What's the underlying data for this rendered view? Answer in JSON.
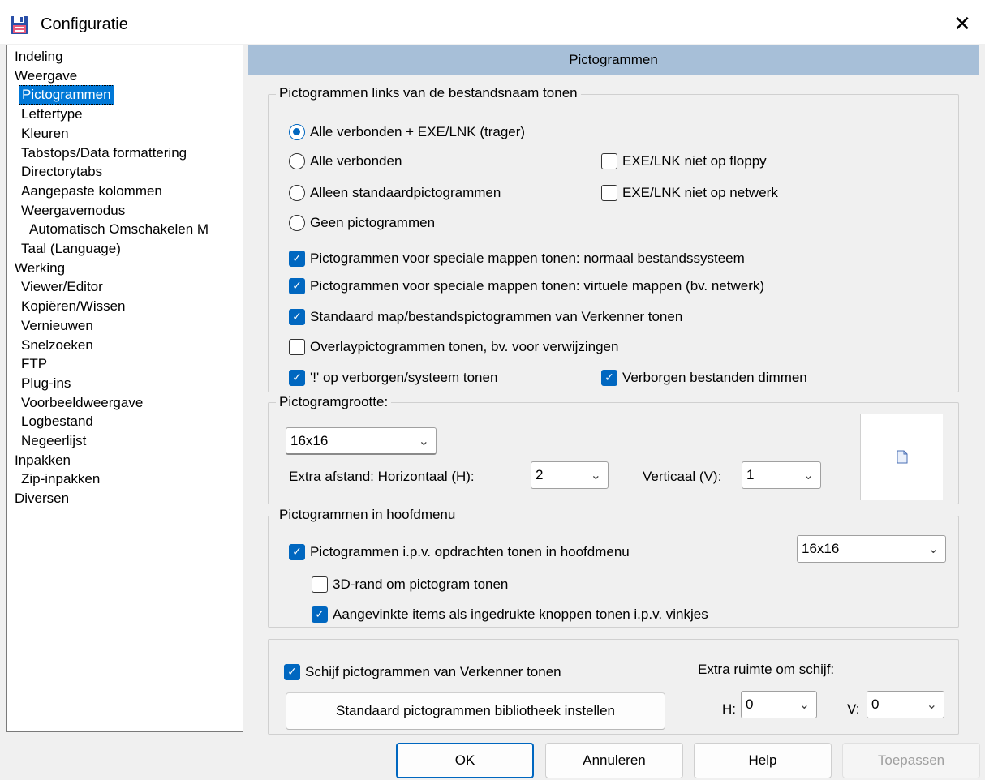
{
  "window": {
    "title": "Configuratie",
    "close_label": "✕"
  },
  "tree": {
    "items": [
      {
        "label": "Indeling",
        "level": 0,
        "selected": false
      },
      {
        "label": "Weergave",
        "level": 0,
        "selected": false
      },
      {
        "label": "Pictogrammen",
        "level": 1,
        "selected": true
      },
      {
        "label": "Lettertype",
        "level": 1,
        "selected": false
      },
      {
        "label": "Kleuren",
        "level": 1,
        "selected": false
      },
      {
        "label": "Tabstops/Data formattering",
        "level": 1,
        "selected": false
      },
      {
        "label": "Directorytabs",
        "level": 1,
        "selected": false
      },
      {
        "label": "Aangepaste kolommen",
        "level": 1,
        "selected": false
      },
      {
        "label": "Weergavemodus",
        "level": 1,
        "selected": false
      },
      {
        "label": "Automatisch Omschakelen M",
        "level": 2,
        "selected": false
      },
      {
        "label": "Taal (Language)",
        "level": 1,
        "selected": false
      },
      {
        "label": "Werking",
        "level": 0,
        "selected": false
      },
      {
        "label": "Viewer/Editor",
        "level": 1,
        "selected": false
      },
      {
        "label": "Kopiëren/Wissen",
        "level": 1,
        "selected": false
      },
      {
        "label": "Vernieuwen",
        "level": 1,
        "selected": false
      },
      {
        "label": "Snelzoeken",
        "level": 1,
        "selected": false
      },
      {
        "label": "FTP",
        "level": 1,
        "selected": false
      },
      {
        "label": "Plug-ins",
        "level": 1,
        "selected": false
      },
      {
        "label": "Voorbeeldweergave",
        "level": 1,
        "selected": false
      },
      {
        "label": "Logbestand",
        "level": 1,
        "selected": false
      },
      {
        "label": "Negeerlijst",
        "level": 1,
        "selected": false
      },
      {
        "label": "Inpakken",
        "level": 0,
        "selected": false
      },
      {
        "label": "Zip-inpakken",
        "level": 1,
        "selected": false
      },
      {
        "label": "Diversen",
        "level": 0,
        "selected": false
      }
    ]
  },
  "panel": {
    "header": "Pictogrammen"
  },
  "group_left": {
    "legend": "Pictogrammen links van de bestandsnaam tonen",
    "radio_all_exe": "Alle verbonden + EXE/LNK (trager)",
    "radio_all": "Alle verbonden",
    "radio_standard": "Alleen standaardpictogrammen",
    "radio_none": "Geen pictogrammen",
    "radio_selected": "all_exe",
    "cb_floppy": "EXE/LNK niet op floppy",
    "cb_floppy_checked": false,
    "cb_network": "EXE/LNK niet op netwerk",
    "cb_network_checked": false,
    "cb_special_normal": "Pictogrammen voor speciale mappen tonen: normaal bestandssysteem",
    "cb_special_normal_checked": true,
    "cb_special_virtual": "Pictogrammen voor speciale mappen tonen: virtuele mappen (bv. netwerk)",
    "cb_special_virtual_checked": true,
    "cb_explorer": "Standaard map/bestandspictogrammen van Verkenner tonen",
    "cb_explorer_checked": true,
    "cb_overlay": "Overlaypictogrammen tonen, bv. voor verwijzingen",
    "cb_overlay_checked": false,
    "cb_hidden_mark": "'!' op verborgen/systeem tonen",
    "cb_hidden_mark_checked": true,
    "cb_dim": "Verborgen bestanden dimmen",
    "cb_dim_checked": true
  },
  "group_size": {
    "legend": "Pictogramgrootte:",
    "size_value": "16x16",
    "extra_label": "Extra afstand: Horizontaal (H):",
    "h_value": "2",
    "v_label": "Verticaal (V):",
    "v_value": "1"
  },
  "group_menu": {
    "legend": "Pictogrammen in hoofdmenu",
    "cb_menu": "Pictogrammen i.p.v. opdrachten tonen in hoofdmenu",
    "cb_menu_checked": true,
    "menu_size_value": "16x16",
    "cb_3d": "3D-rand om pictogram tonen",
    "cb_3d_checked": false,
    "cb_pressed": "Aangevinkte items als ingedrukte knoppen tonen i.p.v. vinkjes",
    "cb_pressed_checked": true
  },
  "group_disk": {
    "cb_disk": "Schijf pictogrammen van Verkenner tonen",
    "cb_disk_checked": true,
    "library_button": "Standaard pictogrammen bibliotheek instellen",
    "extra_space_label": "Extra ruimte om schijf:",
    "h_label": "H:",
    "h_value": "0",
    "v_label": "V:",
    "v_value": "0"
  },
  "buttons": {
    "ok": "OK",
    "cancel": "Annuleren",
    "help": "Help",
    "apply": "Toepassen"
  },
  "colors": {
    "accent": "#0067c0",
    "header_bg": "#a7bfd8",
    "selection": "#0078d7"
  }
}
